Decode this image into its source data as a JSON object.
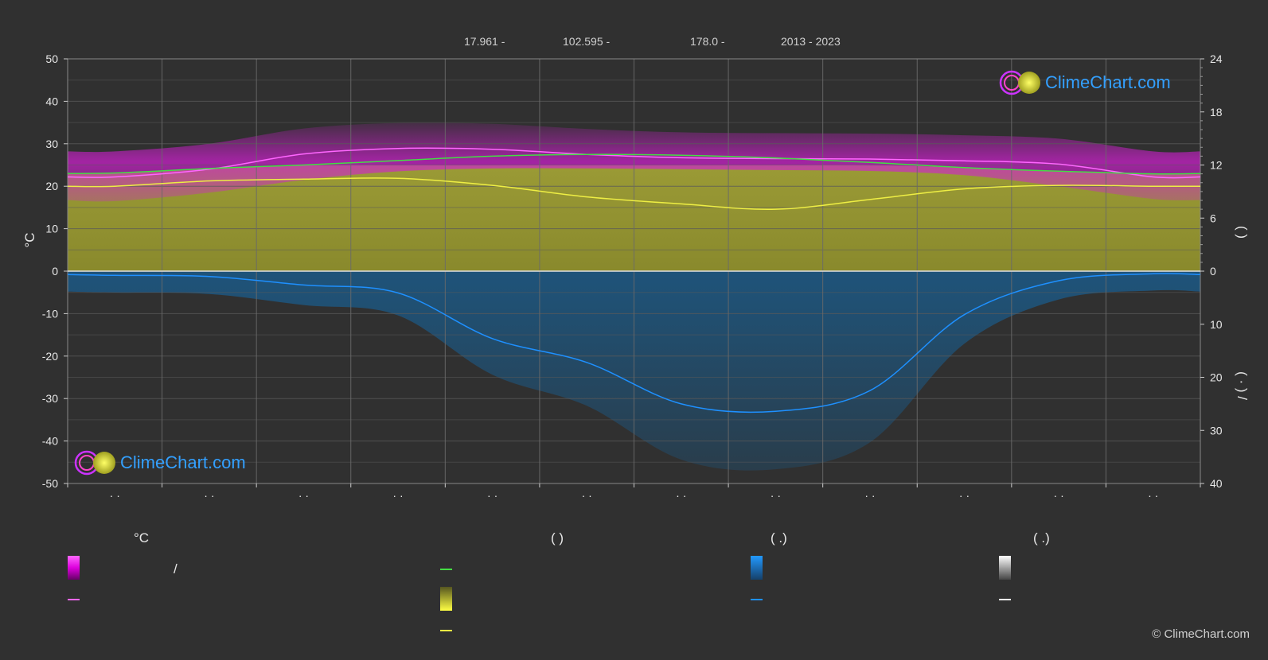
{
  "header": {
    "lat": "17.961 -",
    "lon": "102.595 -",
    "elev": "178.0 -",
    "years": "2013 - 2023"
  },
  "footer": {
    "copyright": "© ClimeChart.com"
  },
  "logo": {
    "text": "ClimeChart.com"
  },
  "legend": {
    "col1_unit": "°C",
    "col1_slash": "/",
    "col2_paren": "(          )",
    "col3_paren": "(    .)",
    "col4_paren": "(    .)"
  },
  "chart_data": {
    "type": "area",
    "months": [
      "· ·",
      "· ·",
      "· ·",
      "· ·",
      "· ·",
      "· ·",
      "· ·",
      "· ·",
      "· ·",
      "· ·",
      "· ·",
      "· ·"
    ],
    "y_left": {
      "label": "°C",
      "ticks": [
        50,
        40,
        30,
        20,
        10,
        0,
        -10,
        -20,
        -30,
        -40,
        -50
      ],
      "range": [
        -50,
        50
      ]
    },
    "y_right_top": {
      "label": "(     )",
      "ticks": [
        24,
        18,
        12,
        6,
        0
      ],
      "range": [
        0,
        24
      ]
    },
    "y_right_bottom": {
      "label": "(  ·  )  /",
      "ticks": [
        0,
        10,
        20,
        30,
        40
      ],
      "range": [
        0,
        40
      ]
    },
    "series": [
      {
        "key": "temp_max",
        "color": "#ff66ff",
        "values": [
          22.2,
          24.0,
          27.6,
          28.9,
          28.7,
          27.5,
          26.7,
          26.5,
          26.4,
          26.0,
          25.2,
          22.2
        ]
      },
      {
        "key": "temp_min",
        "color": "#ffd0ff",
        "values": [
          16.5,
          18.5,
          21.5,
          23.5,
          24.2,
          24.2,
          24.0,
          23.8,
          23.6,
          22.6,
          20.0,
          17.0
        ]
      },
      {
        "key": "daylight",
        "color": "#44dd44",
        "values": [
          11.1,
          11.6,
          12.0,
          12.5,
          13.0,
          13.2,
          13.1,
          12.8,
          12.3,
          11.7,
          11.3,
          11.0
        ]
      },
      {
        "key": "sunshine",
        "color": "#eeee44",
        "values": [
          9.6,
          10.2,
          10.4,
          10.5,
          9.7,
          8.4,
          7.6,
          7.0,
          8.1,
          9.3,
          9.7,
          9.6
        ]
      },
      {
        "key": "precipitation",
        "color": "#1e90ff",
        "values": [
          0.8,
          1.0,
          2.6,
          4.1,
          12.7,
          17.2,
          25.0,
          26.4,
          22.5,
          8.2,
          1.8,
          0.5
        ]
      }
    ],
    "colors": {
      "temp_band": "#d020d0",
      "sunshine_area": "#9a9a30",
      "precip_area": "#1a5c8c",
      "zero_line": "#e0e0e0",
      "grid": "#5a5a5a"
    }
  }
}
